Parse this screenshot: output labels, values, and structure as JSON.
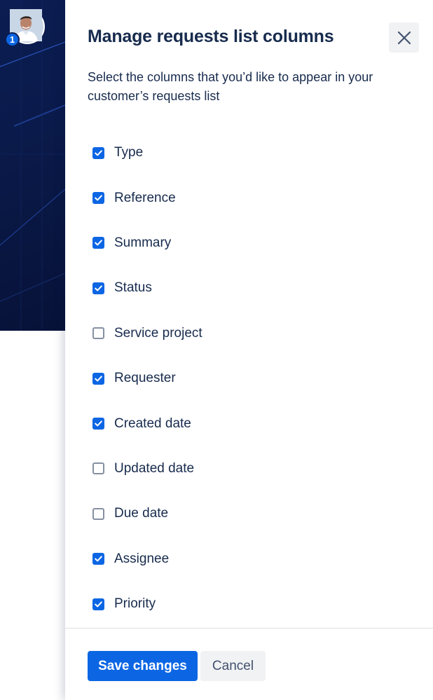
{
  "user": {
    "notification_count": "1"
  },
  "drawer": {
    "title": "Manage requests list columns",
    "description": "Select the columns that you’d like to appear in your customer’s requests list",
    "close_icon": "close-icon"
  },
  "columns": [
    {
      "label": "Type",
      "checked": true
    },
    {
      "label": "Reference",
      "checked": true
    },
    {
      "label": "Summary",
      "checked": true
    },
    {
      "label": "Status",
      "checked": true
    },
    {
      "label": "Service project",
      "checked": false
    },
    {
      "label": "Requester",
      "checked": true
    },
    {
      "label": "Created date",
      "checked": true
    },
    {
      "label": "Updated date",
      "checked": false
    },
    {
      "label": "Due date",
      "checked": false
    },
    {
      "label": "Assignee",
      "checked": true
    },
    {
      "label": "Priority",
      "checked": true
    }
  ],
  "footer": {
    "save_label": "Save changes",
    "cancel_label": "Cancel"
  },
  "colors": {
    "primary": "#0c66e4",
    "text": "#172b4d",
    "background_dark": "#0b1d52"
  }
}
